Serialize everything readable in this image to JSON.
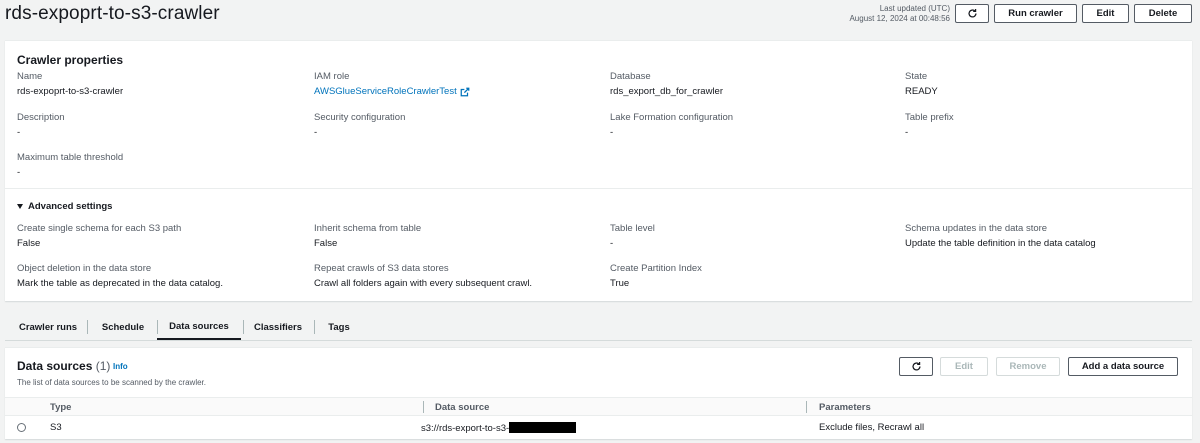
{
  "header": {
    "title": "rds-expoprt-to-s3-crawler",
    "last_updated_label": "Last updated (UTC)",
    "last_updated_value": "August 12, 2024 at 00:48:56",
    "refresh_icon": "refresh-icon",
    "run_label": "Run crawler",
    "edit_label": "Edit",
    "delete_label": "Delete"
  },
  "properties": {
    "title": "Crawler properties",
    "fields": {
      "name": {
        "label": "Name",
        "value": "rds-expoprt-to-s3-crawler"
      },
      "iam_role": {
        "label": "IAM role",
        "value": "AWSGlueServiceRoleCrawlerTest"
      },
      "database": {
        "label": "Database",
        "value": "rds_export_db_for_crawler"
      },
      "state": {
        "label": "State",
        "value": "READY"
      },
      "description": {
        "label": "Description",
        "value": "-"
      },
      "security": {
        "label": "Security configuration",
        "value": "-"
      },
      "lake_formation": {
        "label": "Lake Formation configuration",
        "value": "-"
      },
      "table_prefix": {
        "label": "Table prefix",
        "value": "-"
      },
      "max_threshold": {
        "label": "Maximum table threshold",
        "value": "-"
      }
    }
  },
  "advanced": {
    "title": "Advanced settings",
    "fields": {
      "single_schema": {
        "label": "Create single schema for each S3 path",
        "value": "False"
      },
      "inherit_schema": {
        "label": "Inherit schema from table",
        "value": "False"
      },
      "table_level": {
        "label": "Table level",
        "value": "-"
      },
      "schema_updates": {
        "label": "Schema updates in the data store",
        "value": "Update the table definition in the data catalog"
      },
      "object_deletion": {
        "label": "Object deletion in the data store",
        "value": "Mark the table as deprecated in the data catalog."
      },
      "repeat_crawls": {
        "label": "Repeat crawls of S3 data stores",
        "value": "Crawl all folders again with every subsequent crawl."
      },
      "partition_index": {
        "label": "Create Partition Index",
        "value": "True"
      }
    }
  },
  "tabs": [
    {
      "label": "Crawler runs"
    },
    {
      "label": "Schedule"
    },
    {
      "label": "Data sources"
    },
    {
      "label": "Classifiers"
    },
    {
      "label": "Tags"
    }
  ],
  "data_sources": {
    "title": "Data sources",
    "count": "(1)",
    "info_label": "Info",
    "description": "The list of data sources to be scanned by the crawler.",
    "edit_label": "Edit",
    "remove_label": "Remove",
    "add_label": "Add a data source",
    "columns": [
      "Type",
      "Data source",
      "Parameters"
    ],
    "rows": [
      {
        "type": "S3",
        "source": "s3://rds-export-to-s3-",
        "parameters": "Exclude files, Recrawl all"
      }
    ]
  },
  "colors": {
    "link": "#0073bb",
    "text": "#16191f",
    "muted": "#545b64",
    "background": "#f2f3f3"
  }
}
